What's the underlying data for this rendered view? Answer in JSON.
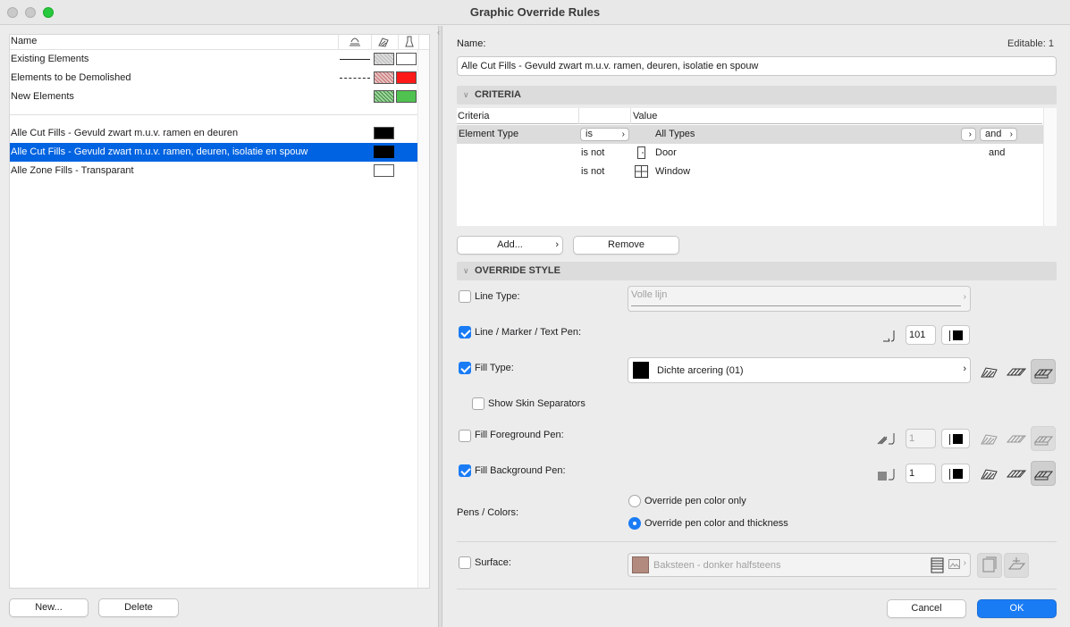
{
  "window": {
    "title": "Graphic Override Rules"
  },
  "list": {
    "header": "Name",
    "items": [
      {
        "label": "Existing Elements",
        "selected": false
      },
      {
        "label": "Elements to be Demolished",
        "selected": false
      },
      {
        "label": "New Elements",
        "selected": false
      },
      {
        "label": "Alle Cut Fills - Gevuld zwart m.u.v. ramen en deuren",
        "selected": false
      },
      {
        "label": "Alle Cut Fills - Gevuld zwart m.u.v. ramen, deuren, isolatie en spouw",
        "selected": true
      },
      {
        "label": "Alle Zone Fills - Transparant",
        "selected": false
      }
    ],
    "new_label": "New...",
    "delete_label": "Delete"
  },
  "detail": {
    "name_label": "Name:",
    "editable": "Editable: 1",
    "name_value": "Alle Cut Fills - Gevuld zwart m.u.v. ramen, deuren, isolatie en spouw",
    "criteria": {
      "title": "CRITERIA",
      "col_criteria": "Criteria",
      "col_value": "Value",
      "rows": [
        {
          "criteria": "Element Type",
          "op": "is",
          "value": "All Types",
          "conj": "and"
        },
        {
          "criteria": "",
          "op": "is not",
          "value": "Door",
          "conj": "and"
        },
        {
          "criteria": "",
          "op": "is not",
          "value": "Window",
          "conj": ""
        }
      ],
      "add_label": "Add...",
      "remove_label": "Remove"
    },
    "override": {
      "title": "OVERRIDE STYLE",
      "line_type": {
        "label": "Line Type:",
        "checked": false,
        "value": "Volle lijn"
      },
      "pen": {
        "label": "Line / Marker / Text Pen:",
        "checked": true,
        "value": "101"
      },
      "fill_type": {
        "label": "Fill Type:",
        "checked": true,
        "value": "Dichte arcering (01)"
      },
      "skin": {
        "label": "Show Skin Separators",
        "checked": false
      },
      "fg_pen": {
        "label": "Fill Foreground Pen:",
        "checked": false,
        "value": "1"
      },
      "bg_pen": {
        "label": "Fill Background Pen:",
        "checked": true,
        "value": "1"
      },
      "pens_colors": {
        "label": "Pens / Colors:",
        "options": [
          "Override pen color only",
          "Override pen color and thickness"
        ],
        "selected": 1
      },
      "surface": {
        "label": "Surface:",
        "checked": false,
        "value": "Baksteen - donker halfsteens",
        "color": "#b28a7e"
      }
    },
    "cancel_label": "Cancel",
    "ok_label": "OK"
  },
  "colors": {
    "accent": "#0063e1",
    "ok": "#1a7cf5",
    "demolish_red": "#ff1a1a",
    "new_green": "#4fc24f"
  }
}
